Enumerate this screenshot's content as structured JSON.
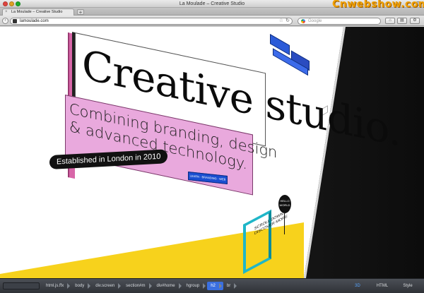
{
  "window": {
    "title": "La Moulade – Creative Studio",
    "watermark": "Cnwebshow.com"
  },
  "tab": {
    "title": "La Moulade – Creative Studio",
    "new_tab_label": "+"
  },
  "toolbar": {
    "url": "lamoulade.com",
    "search_placeholder": "Google",
    "reload_glyph": "↻",
    "bookmark_glyph": "☆"
  },
  "page": {
    "headline": "Creative studio.",
    "tagline_line1": "Combining branding, design",
    "tagline_line2": "& advanced technology.",
    "established": "Established in London in 2010",
    "balloon_text": "HELLO WORLD",
    "scroll_hint_line1": "SCROLL DOWN &",
    "scroll_hint_line2": "DISCOVER MORE",
    "stamp_text": "LEARN · BRANDING · WEB"
  },
  "inspector": {
    "crumbs": [
      {
        "label": "html.js.ffx",
        "active": false
      },
      {
        "label": "body",
        "active": false
      },
      {
        "label": "div.screen",
        "active": false
      },
      {
        "label": "section#m",
        "active": false
      },
      {
        "label": "div#home",
        "active": false
      },
      {
        "label": "hgroup",
        "active": false
      },
      {
        "label": "h2",
        "active": true
      },
      {
        "label": "br",
        "active": false
      }
    ],
    "modes": [
      "3D",
      "HTML",
      "Style"
    ],
    "active_mode": "3D"
  },
  "colors": {
    "accent_pink": "#d866a8",
    "tagline_bg": "#e9a9dd",
    "floor_yellow": "#f7d21c",
    "widget_blue": "#2b5bd8",
    "watermark_orange": "#f0a000"
  }
}
